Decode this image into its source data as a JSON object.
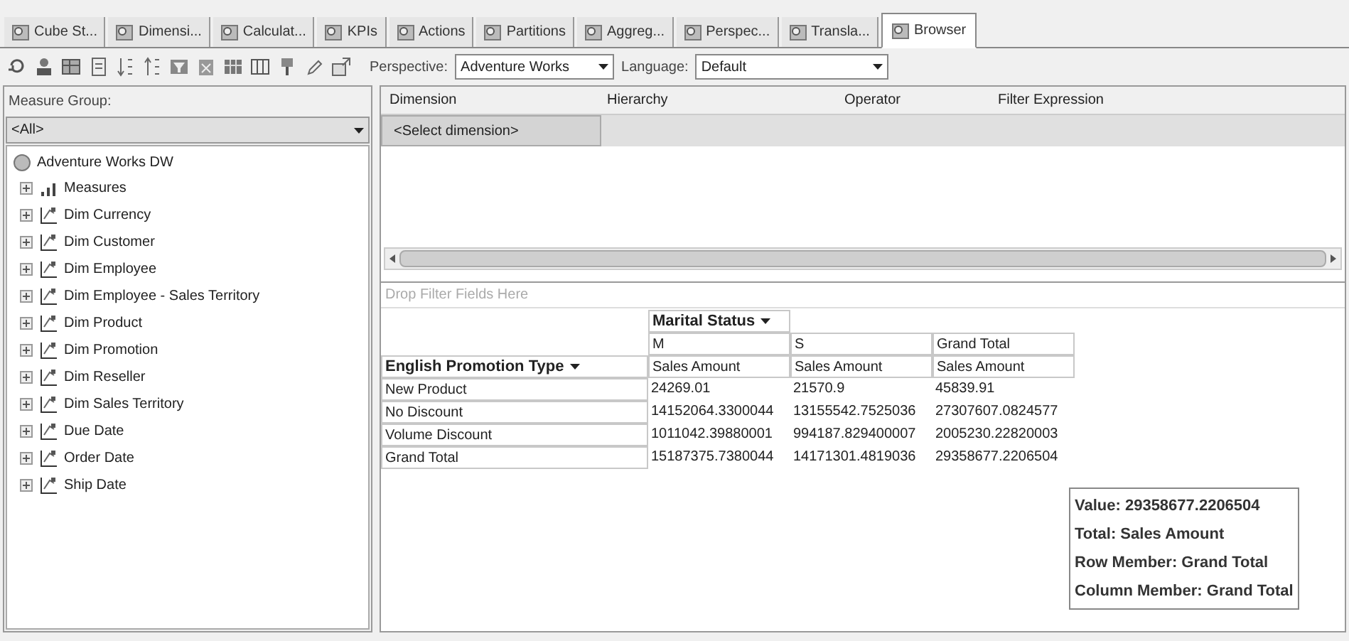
{
  "tabs": [
    {
      "label": "Cube St...",
      "selected": false
    },
    {
      "label": "Dimensi...",
      "selected": false
    },
    {
      "label": "Calculat...",
      "selected": false
    },
    {
      "label": "KPIs",
      "selected": false
    },
    {
      "label": "Actions",
      "selected": false
    },
    {
      "label": "Partitions",
      "selected": false
    },
    {
      "label": "Aggreg...",
      "selected": false
    },
    {
      "label": "Perspec...",
      "selected": false
    },
    {
      "label": "Transla...",
      "selected": false
    },
    {
      "label": "Browser",
      "selected": true
    }
  ],
  "toolbar": {
    "perspective": {
      "label": "Perspective:",
      "value": "Adventure Works"
    },
    "language": {
      "label": "Language:",
      "value": "Default"
    }
  },
  "measure_group": {
    "label": "Measure Group:",
    "value": "<All>"
  },
  "tree": {
    "root": "Adventure Works DW",
    "children": [
      {
        "label": "Measures",
        "kind": "measures",
        "expanded": false
      },
      {
        "label": "Dim Currency",
        "kind": "dimension",
        "expanded": false
      },
      {
        "label": "Dim Customer",
        "kind": "dimension",
        "expanded": false
      },
      {
        "label": "Dim Employee",
        "kind": "dimension",
        "expanded": false
      },
      {
        "label": "Dim Employee - Sales Territory",
        "kind": "dimension",
        "expanded": false
      },
      {
        "label": "Dim Product",
        "kind": "dimension",
        "expanded": false
      },
      {
        "label": "Dim Promotion",
        "kind": "dimension",
        "expanded": false
      },
      {
        "label": "Dim Reseller",
        "kind": "dimension",
        "expanded": false
      },
      {
        "label": "Dim Sales Territory",
        "kind": "dimension",
        "expanded": false
      },
      {
        "label": "Due Date",
        "kind": "dimension",
        "expanded": false
      },
      {
        "label": "Order Date",
        "kind": "dimension",
        "expanded": false
      },
      {
        "label": "Ship Date",
        "kind": "dimension",
        "expanded": false
      }
    ]
  },
  "filter_grid": {
    "columns": [
      "Dimension",
      "Hierarchy",
      "Operator",
      "Filter Expression"
    ],
    "rows": [
      {
        "dimension": "<Select dimension>"
      }
    ],
    "drop_zone": "Drop Filter Fields Here"
  },
  "pivot": {
    "column_field": "Marital Status",
    "row_field": "English Promotion Type",
    "column_members": [
      "M",
      "S",
      "Grand Total"
    ],
    "measures": [
      "Sales Amount",
      "Sales Amount",
      "Sales Amount"
    ],
    "rows": [
      {
        "label": "New Product",
        "values": [
          "24269.01",
          "21570.9",
          "45839.91"
        ]
      },
      {
        "label": "No Discount",
        "values": [
          "14152064.3300044",
          "13155542.7525036",
          "27307607.0824577"
        ]
      },
      {
        "label": "Volume Discount",
        "values": [
          "1011042.39880001",
          "994187.829400007",
          "2005230.22820003"
        ]
      },
      {
        "label": "Grand Total",
        "values": [
          "15187375.7380044",
          "14171301.4819036",
          "29358677.2206504"
        ]
      }
    ]
  },
  "tooltip": [
    "Value: 29358677.2206504",
    "Total: Sales Amount",
    "Row Member: Grand Total",
    "Column Member: Grand Total"
  ]
}
